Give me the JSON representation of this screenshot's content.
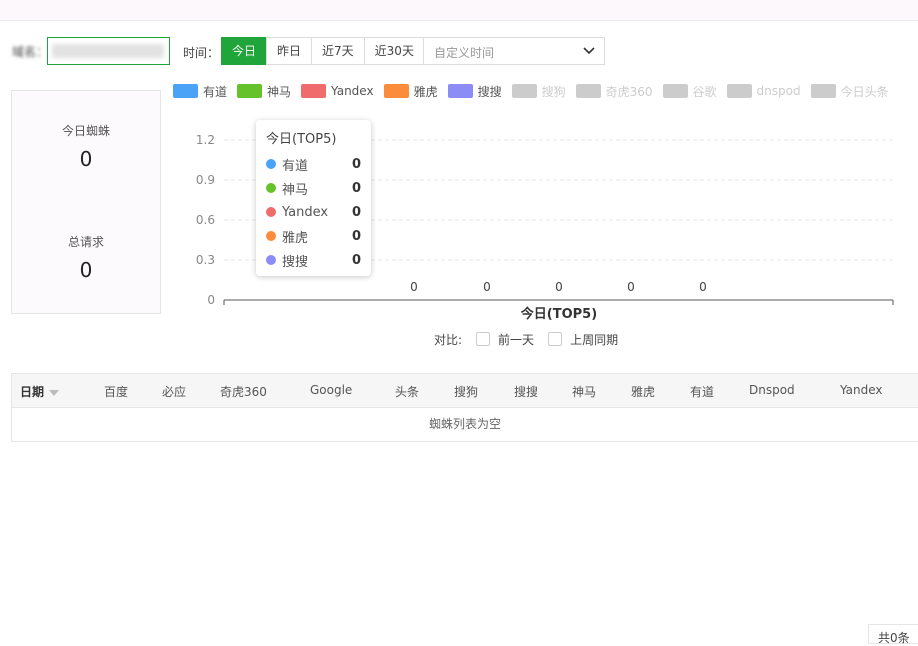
{
  "filter": {
    "domain_label": "域名：",
    "time_label": "时间：",
    "time_buttons": [
      "今日",
      "昨日",
      "近7天",
      "近30天"
    ],
    "active_button": "今日",
    "custom_placeholder": "自定义时间"
  },
  "stats": {
    "spider_label": "今日蜘蛛",
    "spider_value": "0",
    "requests_label": "总请求",
    "requests_value": "0"
  },
  "legend": [
    {
      "name": "有道",
      "color": "#4aa3f7",
      "active": true
    },
    {
      "name": "神马",
      "color": "#66c22b",
      "active": true
    },
    {
      "name": "Yandex",
      "color": "#f06c6c",
      "active": true
    },
    {
      "name": "雅虎",
      "color": "#fa8c3c",
      "active": true
    },
    {
      "name": "搜搜",
      "color": "#8c8cf7",
      "active": true
    },
    {
      "name": "搜狗",
      "color": "#cccccc",
      "active": false
    },
    {
      "name": "奇虎360",
      "color": "#cccccc",
      "active": false
    },
    {
      "name": "谷歌",
      "color": "#cccccc",
      "active": false
    },
    {
      "name": "dnspod",
      "color": "#cccccc",
      "active": false
    },
    {
      "name": "今日头条",
      "color": "#cccccc",
      "active": false
    }
  ],
  "chart_data": {
    "type": "bar",
    "xlabel": "今日(TOP5)",
    "yticks": [
      "1.2",
      "0.9",
      "0.6",
      "0.3",
      "0"
    ],
    "ylim": [
      0,
      1.2
    ],
    "series": [
      {
        "name": "有道",
        "values": [
          0
        ]
      },
      {
        "name": "神马",
        "values": [
          0
        ]
      },
      {
        "name": "Yandex",
        "values": [
          0
        ]
      },
      {
        "name": "雅虎",
        "values": [
          0
        ]
      },
      {
        "name": "搜搜",
        "values": [
          0
        ]
      }
    ],
    "data_labels": [
      "0",
      "0",
      "0",
      "0",
      "0"
    ],
    "grid": true
  },
  "tooltip": {
    "title": "今日(TOP5)",
    "rows": [
      {
        "name": "有道",
        "value": "0",
        "color": "#4aa3f7"
      },
      {
        "name": "神马",
        "value": "0",
        "color": "#66c22b"
      },
      {
        "name": "Yandex",
        "value": "0",
        "color": "#f06c6c"
      },
      {
        "name": "雅虎",
        "value": "0",
        "color": "#fa8c3c"
      },
      {
        "name": "搜搜",
        "value": "0",
        "color": "#8c8cf7"
      }
    ]
  },
  "compare": {
    "label": "对比:",
    "options": [
      "前一天",
      "上周同期"
    ]
  },
  "table": {
    "columns": [
      "日期",
      "百度",
      "必应",
      "奇虎360",
      "Google",
      "头条",
      "搜狗",
      "搜搜",
      "神马",
      "雅虎",
      "有道",
      "Dnspod",
      "Yandex"
    ],
    "empty_text": "蜘蛛列表为空"
  },
  "pager": {
    "total_text": "共0条"
  }
}
